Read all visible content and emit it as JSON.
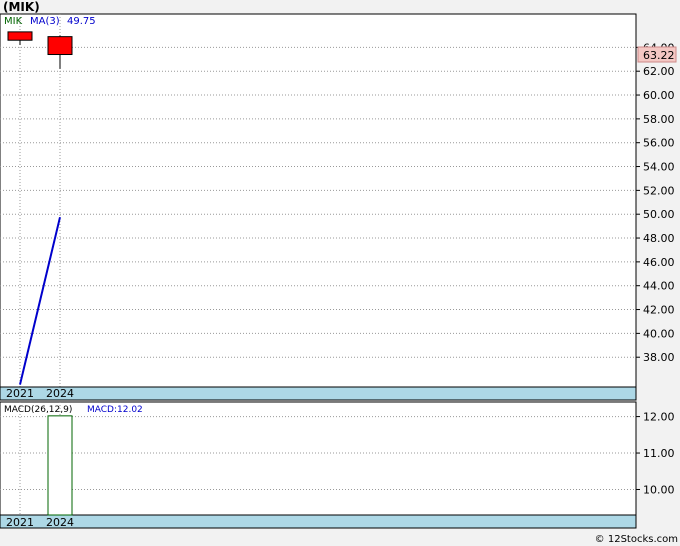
{
  "title": "(MIK)",
  "footer": "© 12Stocks.com",
  "colors": {
    "candle": "#ff0000",
    "ma_line": "#0000cc",
    "last_price_bg": "#f4c7c3",
    "axis_band": "#add8e6",
    "grid": "#999999",
    "macd_bar": "#006400",
    "ticker_legend": "#006400"
  },
  "chart_data": [
    {
      "type": "candlestick",
      "legend": {
        "ticker": "MIK",
        "ma_label": "MA(3)",
        "ma_value": "49.75"
      },
      "x_labels": [
        "2021",
        "2024"
      ],
      "yticks": [
        "38.00",
        "40.00",
        "42.00",
        "44.00",
        "46.00",
        "48.00",
        "50.00",
        "52.00",
        "54.00",
        "56.00",
        "58.00",
        "60.00",
        "62.00",
        "64.00"
      ],
      "ylim": [
        35.5,
        66.8
      ],
      "last_price": "63.22",
      "candles": [
        {
          "x": "2021",
          "open": 64.6,
          "close": 65.3,
          "high": 65.3,
          "low": 64.2
        },
        {
          "x": "2024",
          "open": 64.9,
          "close": 63.4,
          "high": 65.0,
          "low": 62.2
        }
      ],
      "ma_series": [
        {
          "x": "2021",
          "y": 35.7
        },
        {
          "x": "2024",
          "y": 49.75
        }
      ]
    },
    {
      "type": "bar",
      "legend": {
        "label": "MACD(26,12,9)",
        "macd_label": "MACD:12.02"
      },
      "x_labels": [
        "2021",
        "2024"
      ],
      "yticks": [
        "10.00",
        "11.00",
        "12.00"
      ],
      "ylim": [
        9.3,
        12.4
      ],
      "bars": [
        {
          "x": "2024",
          "value": 12.02
        }
      ]
    }
  ]
}
